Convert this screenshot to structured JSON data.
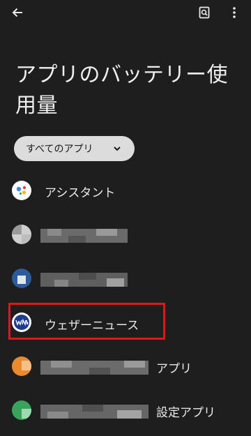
{
  "header": {
    "back_icon": "arrow-left-icon",
    "search_icon": "document-search-icon",
    "more_icon": "more-vert-icon"
  },
  "title": {
    "line1": "アプリのバッテリー使",
    "line2": "用量"
  },
  "filter": {
    "selected": "すべてのアプリ",
    "icon": "chevron-down-icon"
  },
  "apps": [
    {
      "label": "アシスタント",
      "icon": "google-assistant-icon"
    },
    {
      "label": "",
      "icon": "app-icon",
      "redacted": true
    },
    {
      "label": "",
      "icon": "app-icon",
      "redacted": true
    },
    {
      "label": "ウェザーニュース",
      "icon": "weathernews-icon",
      "highlighted": true
    },
    {
      "label": "アプリ",
      "icon": "app-icon",
      "redacted": true
    },
    {
      "label": "設定アプリ",
      "icon": "app-icon",
      "redacted": true
    }
  ],
  "colors": {
    "background": "#1e1e1e",
    "chip": "#dcdcdc",
    "highlight": "#e0161b"
  }
}
